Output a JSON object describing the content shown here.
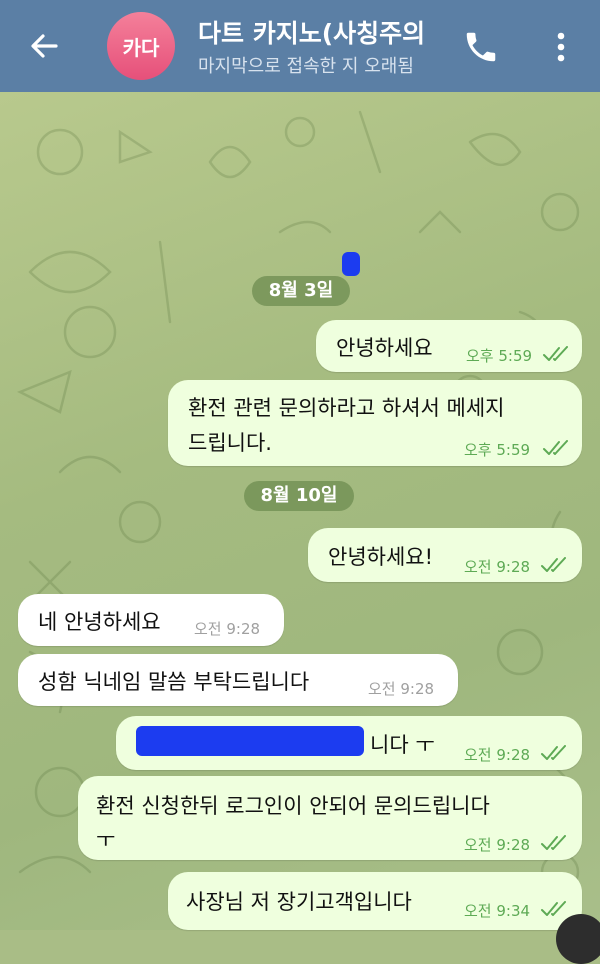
{
  "header": {
    "avatar_text": "카다",
    "title": "다트 카지노(사칭주의",
    "subtitle": "마지막으로 접속한 지 오래됨",
    "back_icon": "arrow-left-icon",
    "call_icon": "phone-icon",
    "menu_icon": "more-vert-icon"
  },
  "colors": {
    "header": "#5b7fa5",
    "avatar": "#e6507a",
    "outgoing_bubble": "#efffde",
    "incoming_bubble": "#ffffff",
    "time_out": "#5eaa55",
    "redaction": "#1c3cf0"
  },
  "dates": [
    "8월 3일",
    "8월 10일"
  ],
  "messages": [
    {
      "dir": "out",
      "text": "안녕하세요",
      "time": "오후 5:59",
      "read": true
    },
    {
      "dir": "out",
      "text_line1": "환전 관련 문의하라고 하셔서 메세지",
      "text_line2": "드립니다.",
      "time": "오후 5:59",
      "read": true
    },
    {
      "dir": "out",
      "text": "안녕하세요!",
      "time": "오전 9:28",
      "read": true
    },
    {
      "dir": "in",
      "text": "네 안녕하세요",
      "time": "오전 9:28"
    },
    {
      "dir": "in",
      "text": "성함 닉네임 말씀 부탁드립니다",
      "time": "오전 9:28"
    },
    {
      "dir": "out",
      "text": "니다 ㅜ",
      "time": "오전 9:28",
      "read": true,
      "redacted": true
    },
    {
      "dir": "out",
      "text_line1": "환전 신청한뒤 로그인이 안되어 문의드립니다",
      "text_line2": "ㅜ",
      "time": "오전 9:28",
      "read": true
    },
    {
      "dir": "out",
      "text": "사장님 저 장기고객입니다",
      "time": "오전 9:34",
      "read": true
    }
  ]
}
